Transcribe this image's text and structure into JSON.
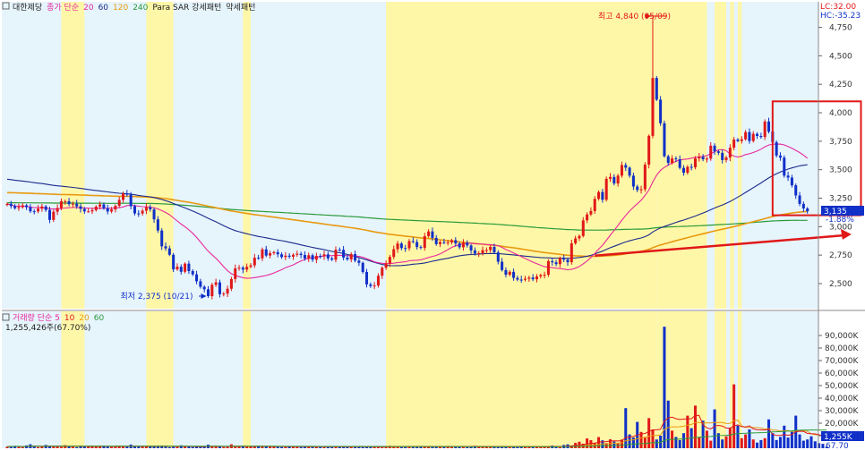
{
  "colors": {
    "panel_bg": "#e6f4fc",
    "band": "#fff7a8",
    "up": "#e01818",
    "down": "#1030c8",
    "ma5": "#e8289c",
    "ma20": "#e8289c",
    "ma60": "#1a2a8c",
    "ma120": "#e89a10",
    "ma240": "#2a9a3a",
    "annot": "#e01818",
    "grid": "#c8d8e8"
  },
  "legend_price": {
    "items": [
      {
        "text": "대한제당",
        "color": "#222222"
      },
      {
        "text": "종가 단순",
        "color": "#e8289c"
      },
      {
        "text": "20",
        "color": "#e8289c"
      },
      {
        "text": "60",
        "color": "#1a2a8c"
      },
      {
        "text": "120",
        "color": "#e89a10"
      },
      {
        "text": "240",
        "color": "#2a9a3a"
      },
      {
        "text": "Para SAR 강세패턴",
        "color": "#222222"
      },
      {
        "text": "약세패턴",
        "color": "#222222"
      }
    ]
  },
  "legend_volume": {
    "items": [
      {
        "text": "거래량 단순 5",
        "color": "#e8289c"
      },
      {
        "text": "10",
        "color": "#e01818"
      },
      {
        "text": "20",
        "color": "#e89a10"
      },
      {
        "text": "60",
        "color": "#2a9a3a"
      }
    ],
    "sub": "1,255,426주(67.70%)"
  },
  "top_right": {
    "lc": "LC:32.00",
    "hc": "HC:-35.23"
  },
  "price_badge": {
    "price": "3,135",
    "change": "-1.88%"
  },
  "volume_badge": {
    "value": "1,255K",
    "pct": "67.70"
  },
  "annotations": {
    "high": "최고 4,840 (05/09)",
    "low": "최저 2,375 (10/21)"
  },
  "chart_data": [
    {
      "type": "candlestick",
      "title": "대한제당",
      "y_ticks": [
        "4,750",
        "4,500",
        "4,250",
        "4,000",
        "3,750",
        "3,500",
        "3,250",
        "3,000",
        "2,750",
        "2,500"
      ],
      "y_tick_values": [
        4750,
        4500,
        4250,
        4000,
        3750,
        3500,
        3250,
        3000,
        2750,
        2500
      ],
      "ylim": [
        2280,
        4880
      ],
      "n": 220,
      "close": [
        3200,
        3181,
        3162,
        3171,
        3187,
        3171,
        3135,
        3134,
        3158,
        3177,
        3147,
        3059,
        3131,
        3163,
        3223,
        3223,
        3198,
        3201,
        3178,
        3156,
        3134,
        3134,
        3145,
        3176,
        3195,
        3162,
        3133,
        3151,
        3183,
        3235,
        3290,
        3281,
        3180,
        3116,
        3115,
        3140,
        3171,
        3151,
        3064,
        2966,
        2827,
        2809,
        2753,
        2625,
        2648,
        2604,
        2675,
        2610,
        2581,
        2520,
        2472,
        2450,
        2390,
        2489,
        2511,
        2407,
        2412,
        2455,
        2540,
        2634,
        2640,
        2623,
        2647,
        2660,
        2727,
        2722,
        2801,
        2746,
        2767,
        2776,
        2757,
        2733,
        2745,
        2736,
        2753,
        2762,
        2751,
        2720,
        2749,
        2710,
        2743,
        2740,
        2756,
        2721,
        2710,
        2797,
        2796,
        2728,
        2713,
        2759,
        2702,
        2682,
        2602,
        2493,
        2479,
        2483,
        2569,
        2639,
        2677,
        2734,
        2802,
        2852,
        2812,
        2810,
        2873,
        2865,
        2821,
        2813,
        2917,
        2958,
        2901,
        2847,
        2864,
        2862,
        2862,
        2881,
        2852,
        2819,
        2859,
        2835,
        2791,
        2765,
        2767,
        2794,
        2794,
        2822,
        2774,
        2692,
        2619,
        2578,
        2603,
        2550,
        2535,
        2534,
        2543,
        2553,
        2538,
        2563,
        2575,
        2578,
        2697,
        2687,
        2671,
        2725,
        2710,
        2688,
        2853,
        2897,
        2918,
        3055,
        3107,
        3137,
        3244,
        3304,
        3236,
        3420,
        3436,
        3379,
        3448,
        3541,
        3518,
        3448,
        3352,
        3322,
        3328,
        3544,
        3797,
        4305,
        4115,
        3908,
        3618,
        3559,
        3599,
        3592,
        3516,
        3473,
        3525,
        3521,
        3599,
        3612,
        3592,
        3597,
        3711,
        3661,
        3648,
        3585,
        3607,
        3693,
        3765,
        3752,
        3767,
        3830,
        3752,
        3815,
        3796,
        3787,
        3923,
        3834,
        3742,
        3624,
        3606,
        3448,
        3431,
        3363,
        3274,
        3200,
        3160,
        3135
      ],
      "ma_series": [
        "ma20",
        "ma60",
        "ma120",
        "ma240"
      ]
    },
    {
      "type": "bar",
      "title": "거래량",
      "y_ticks": [
        "90,000K",
        "80,000K",
        "70,000K",
        "60,000K",
        "50,000K",
        "40,000K",
        "30,000K",
        "20,000K",
        "10,000K"
      ],
      "y_tick_values": [
        90000,
        80000,
        70000,
        60000,
        50000,
        40000,
        30000,
        20000,
        10000
      ],
      "ylim": [
        0,
        100000
      ],
      "note": "volume in thousands of shares; bars colored by candle direction",
      "values": [
        1200,
        1500,
        1800,
        1100,
        900,
        2200,
        3100,
        1300,
        800,
        1400,
        2600,
        1700,
        1200,
        1900,
        1000,
        2400,
        1600,
        1100,
        800,
        2000,
        1300,
        1500,
        1900,
        1200,
        1700,
        2100,
        1400,
        1000,
        1800,
        1600,
        1300,
        1100,
        2900,
        1500,
        1200,
        1800,
        1400,
        1700,
        1900,
        1500,
        2100,
        1200,
        800,
        1000,
        1300,
        2300,
        1400,
        1100,
        900,
        1700,
        1500,
        1200,
        2800,
        1600,
        1300,
        1100,
        900,
        1400,
        3100,
        1800,
        1300,
        1700,
        1100,
        1200,
        1500,
        1900,
        1100,
        1400,
        1300,
        1200,
        1600,
        900,
        1000,
        1400,
        1200,
        1100,
        900,
        1300,
        1500,
        1000,
        1200,
        1400,
        1100,
        1300,
        900,
        1200,
        1100,
        1000,
        1500,
        1300,
        1200,
        1400,
        1100,
        1000,
        1600,
        1200,
        1300,
        1100,
        1500,
        1900,
        1700,
        1200,
        1000,
        1400,
        1300,
        1100,
        1600,
        1500,
        1200,
        1400,
        1100,
        1300,
        1800,
        1200,
        1100,
        1500,
        1300,
        1400,
        1200,
        1000,
        1600,
        1900,
        1400,
        1300,
        1100,
        1200,
        1300,
        1000,
        1500,
        1200,
        1100,
        1400,
        1300,
        1600,
        1200,
        1100,
        1000,
        1300,
        1200,
        1400,
        1100,
        2100,
        1800,
        1500,
        2600,
        3100,
        2200,
        4300,
        5200,
        3600,
        7800,
        6400,
        4200,
        8900,
        6300,
        4100,
        7100,
        5300,
        3800,
        6900,
        32000,
        11000,
        8500,
        21000,
        13000,
        9000,
        24000,
        15000,
        7000,
        10000,
        97000,
        38000,
        14000,
        9000,
        6500,
        12000,
        26000,
        16000,
        34000,
        9000,
        22000,
        14000,
        6000,
        31000,
        12000,
        7000,
        9500,
        16000,
        51000,
        18000,
        8000,
        11000,
        15000,
        7000,
        4500,
        6500,
        8000,
        23000,
        12000,
        6500,
        9000,
        18000,
        8500,
        14000,
        26000,
        11000,
        6000,
        7000,
        9500,
        5500,
        4000,
        3500,
        1255
      ]
    }
  ]
}
